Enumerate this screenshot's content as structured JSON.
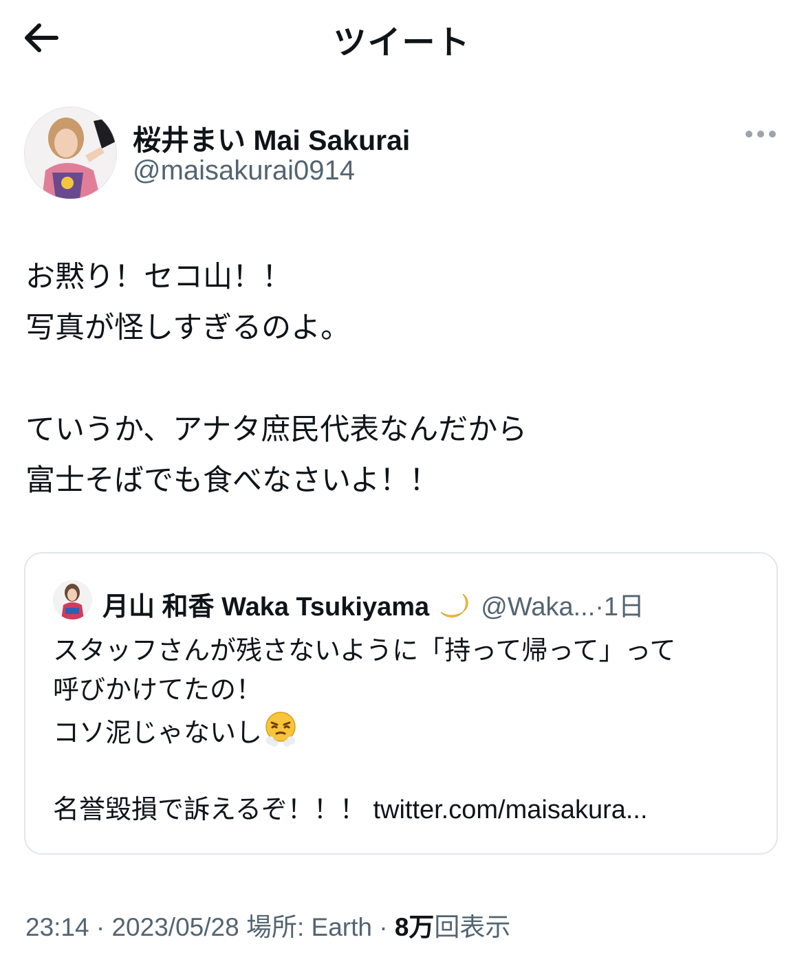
{
  "header": {
    "title": "ツイート",
    "back_icon": "arrow-left-icon"
  },
  "author": {
    "display_name": "桜井まい Mai Sakurai",
    "handle": "@maisakurai0914",
    "more_icon": "more-horizontal-icon"
  },
  "tweet": {
    "lines": [
      "お黙り！セコ山！！",
      "写真が怪しすぎるのよ。",
      "",
      "ていうか、アナタ庶民代表なんだから",
      "富士そばでも食べなさいよ！！"
    ]
  },
  "quoted": {
    "display_name": "月山 和香 Waka Tsukiyama",
    "name_emoji": "crescent-moon-icon",
    "handle": "@Waka...",
    "separator": "·",
    "time": "1日",
    "line1": "スタッフさんが残さないように「持って帰って」って",
    "line2": "呼びかけてたの！",
    "line3": "コソ泥じゃないし",
    "line3_emoji": "face-with-steam-icon",
    "line4": "名誉毀損で訴えるぞ！！！",
    "link": "twitter.com/maisakura..."
  },
  "footer": {
    "time": "23:14",
    "sep1": "·",
    "date": "2023/05/28",
    "location_label": "場所: Earth",
    "sep2": "·",
    "views_count": "8万",
    "views_label": "回表示"
  }
}
